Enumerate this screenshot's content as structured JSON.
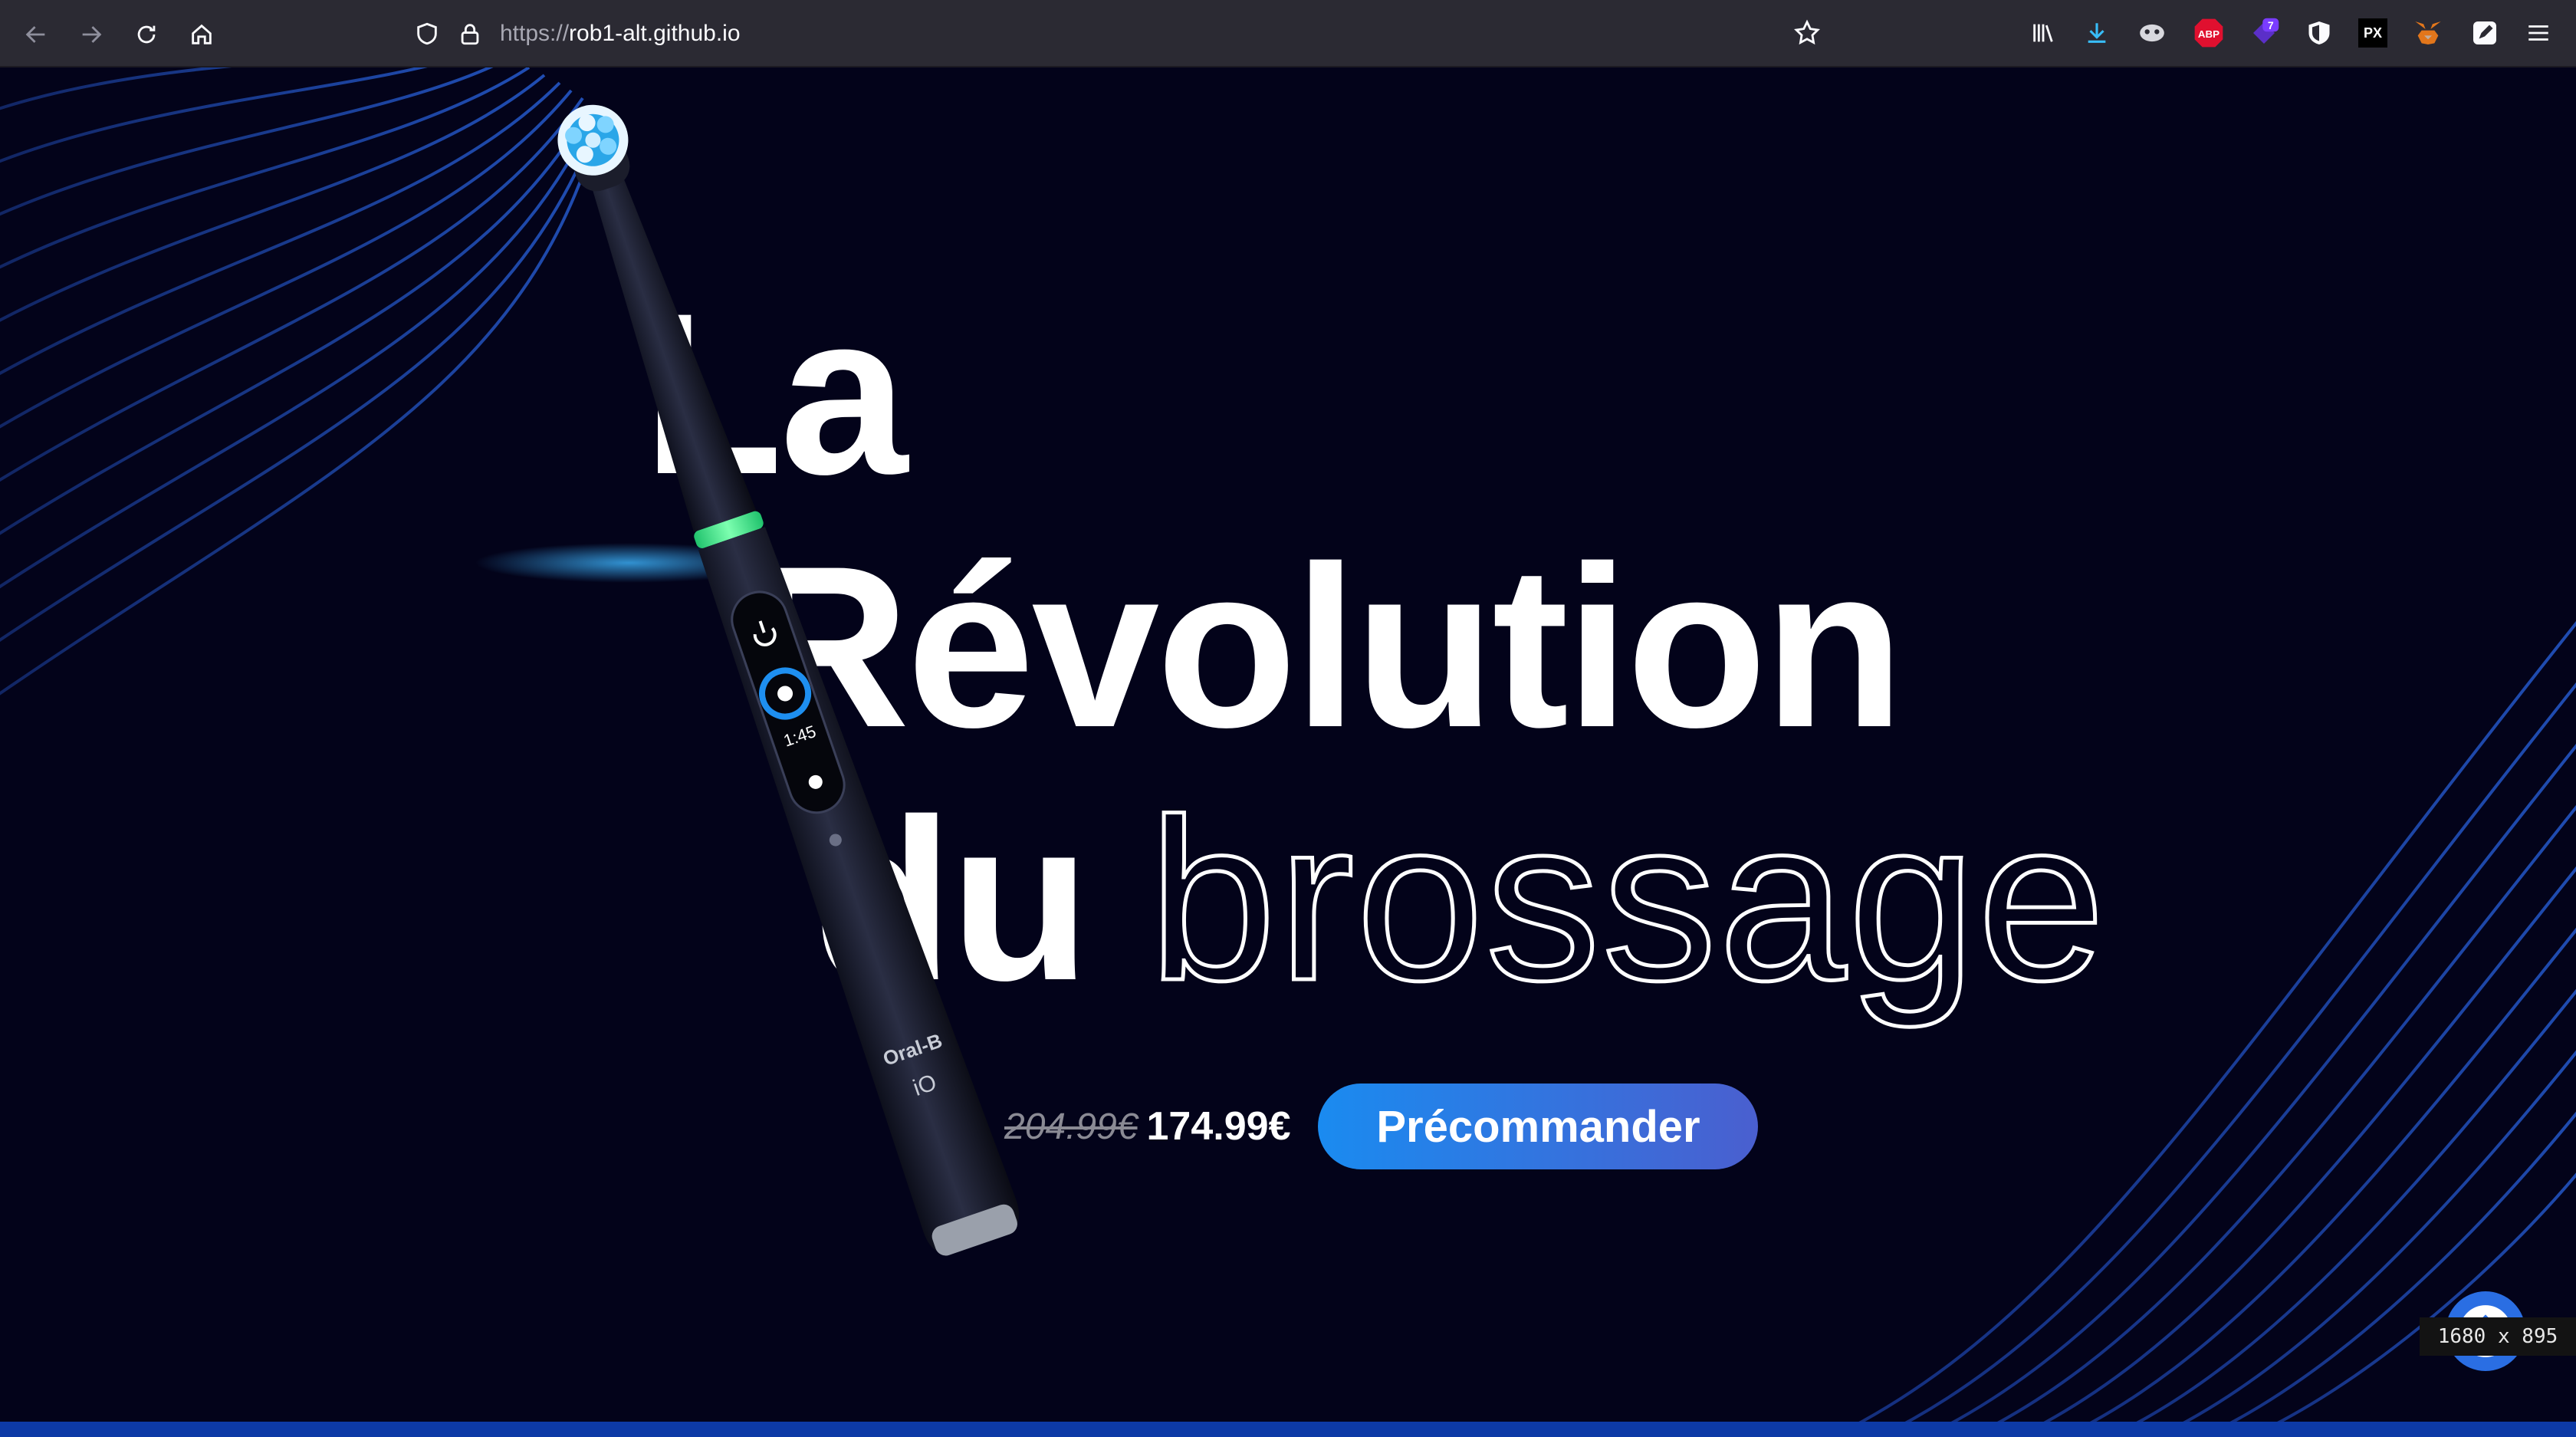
{
  "browser": {
    "url_scheme": "https://",
    "url_host": "rob1-alt.github.io",
    "extensions": [
      {
        "name": "library-icon"
      },
      {
        "name": "downloads-icon"
      },
      {
        "name": "mask-extension-icon"
      },
      {
        "name": "adblock-plus-icon",
        "label": "ABP",
        "color": "#e0102f"
      },
      {
        "name": "badge-extension-icon",
        "badge": "7",
        "color": "#5b2fc8"
      },
      {
        "name": "shield-extension-icon"
      },
      {
        "name": "px-extension-icon",
        "label": "PX"
      },
      {
        "name": "metamask-fox-icon",
        "color": "#e2761b"
      },
      {
        "name": "pencil-extension-icon"
      }
    ]
  },
  "hero": {
    "line1": "La",
    "line2": "Révolution",
    "line3_solid": "du",
    "line3_outline": "brossage",
    "old_price": "204.99€",
    "new_price": "174.99€",
    "cta_label": "Précommander"
  },
  "product": {
    "brand": "Oral-B",
    "model": "iO",
    "timer": "1:45"
  },
  "viewport_size": "1680 x 895",
  "colors": {
    "background": "#03031a",
    "accent_blue": "#1a8bf0",
    "accent_purple": "#4a5fcf",
    "wave_blue": "#1f5bd6",
    "ring_green": "#2ef07a"
  }
}
